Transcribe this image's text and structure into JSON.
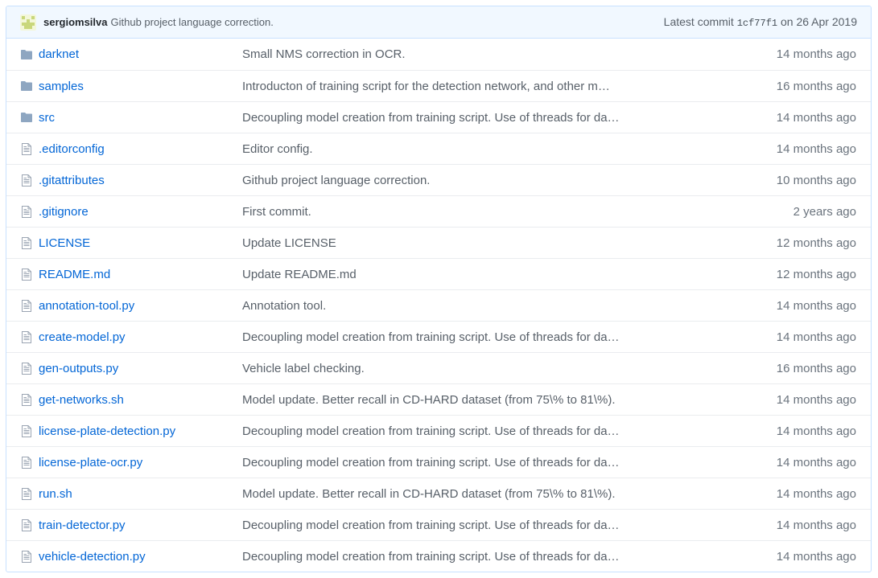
{
  "commit": {
    "author": "sergiomsilva",
    "message": "Github project language correction.",
    "latest_label": "Latest commit",
    "sha": "1cf77f1",
    "date_text": "on 26 Apr 2019"
  },
  "colors": {
    "link": "#0366d6",
    "muted": "#586069",
    "header_bg": "#f1f8ff",
    "folder_icon": "#79b8ff",
    "file_icon": "#6a737d"
  },
  "files": [
    {
      "type": "directory",
      "icon": "folder-icon",
      "name": "darknet",
      "message": "Small NMS correction in OCR.",
      "age": "14 months ago"
    },
    {
      "type": "directory",
      "icon": "folder-icon",
      "name": "samples",
      "message": "Introducton of training script for the detection network, and other m…",
      "age": "16 months ago"
    },
    {
      "type": "directory",
      "icon": "folder-icon",
      "name": "src",
      "message": "Decoupling model creation from training script. Use of threads for da…",
      "age": "14 months ago"
    },
    {
      "type": "file",
      "icon": "file-icon",
      "name": ".editorconfig",
      "message": "Editor config.",
      "age": "14 months ago"
    },
    {
      "type": "file",
      "icon": "file-icon",
      "name": ".gitattributes",
      "message": "Github project language correction.",
      "age": "10 months ago"
    },
    {
      "type": "file",
      "icon": "file-icon",
      "name": ".gitignore",
      "message": "First commit.",
      "age": "2 years ago"
    },
    {
      "type": "file",
      "icon": "file-icon",
      "name": "LICENSE",
      "message": "Update LICENSE",
      "age": "12 months ago"
    },
    {
      "type": "file",
      "icon": "file-icon",
      "name": "README.md",
      "message": "Update README.md",
      "age": "12 months ago"
    },
    {
      "type": "file",
      "icon": "file-icon",
      "name": "annotation-tool.py",
      "message": "Annotation tool.",
      "age": "14 months ago"
    },
    {
      "type": "file",
      "icon": "file-icon",
      "name": "create-model.py",
      "message": "Decoupling model creation from training script. Use of threads for da…",
      "age": "14 months ago"
    },
    {
      "type": "file",
      "icon": "file-icon",
      "name": "gen-outputs.py",
      "message": "Vehicle label checking.",
      "age": "16 months ago"
    },
    {
      "type": "file",
      "icon": "file-icon",
      "name": "get-networks.sh",
      "message": "Model update. Better recall in CD-HARD dataset (from 75\\% to 81\\%).",
      "age": "14 months ago"
    },
    {
      "type": "file",
      "icon": "file-icon",
      "name": "license-plate-detection.py",
      "message": "Decoupling model creation from training script. Use of threads for da…",
      "age": "14 months ago"
    },
    {
      "type": "file",
      "icon": "file-icon",
      "name": "license-plate-ocr.py",
      "message": "Decoupling model creation from training script. Use of threads for da…",
      "age": "14 months ago"
    },
    {
      "type": "file",
      "icon": "file-icon",
      "name": "run.sh",
      "message": "Model update. Better recall in CD-HARD dataset (from 75\\% to 81\\%).",
      "age": "14 months ago"
    },
    {
      "type": "file",
      "icon": "file-icon",
      "name": "train-detector.py",
      "message": "Decoupling model creation from training script. Use of threads for da…",
      "age": "14 months ago"
    },
    {
      "type": "file",
      "icon": "file-icon",
      "name": "vehicle-detection.py",
      "message": "Decoupling model creation from training script. Use of threads for da…",
      "age": "14 months ago"
    }
  ]
}
